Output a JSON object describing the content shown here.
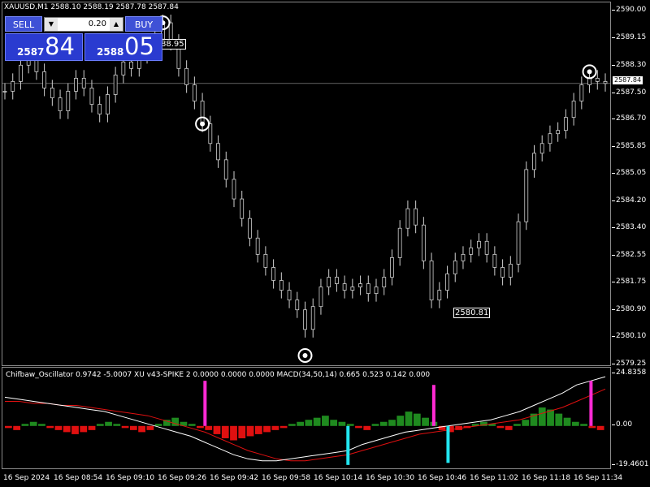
{
  "header": {
    "symbol_line": "XAUUSD,M1  2588.10 2588.19 2587.78 2587.84"
  },
  "trade_panel": {
    "sell_label": "SELL",
    "buy_label": "BUY",
    "lot_value": "0.20",
    "sell_small": "2587",
    "sell_big": "84",
    "buy_small": "2588",
    "buy_big": "05"
  },
  "price_axis": {
    "ticks": [
      "2590.00",
      "2589.15",
      "2588.30",
      "2587.50",
      "2586.70",
      "2585.85",
      "2585.05",
      "2584.20",
      "2583.40",
      "2582.55",
      "2581.75",
      "2580.90",
      "2580.10",
      "2579.25"
    ],
    "current_price": "2587.84"
  },
  "annotations": {
    "low_label": "2580.81",
    "hi_label": "88.95"
  },
  "oscillator": {
    "header": "Chifbaw_Oscillator 0.9742 -5.0007  XU v43-SPIKE 2 0.0000 0.0000 0.0000  MACD(34,50,14) 0.665 0.523 0.142 0.000",
    "axis_ticks": [
      "24.8358",
      "0.00",
      "-19.4601"
    ]
  },
  "time_axis": {
    "ticks": [
      "16 Sep 2024",
      "16 Sep 08:54",
      "16 Sep 09:10",
      "16 Sep 09:26",
      "16 Sep 09:42",
      "16 Sep 09:58",
      "16 Sep 10:14",
      "16 Sep 10:30",
      "16 Sep 10:46",
      "16 Sep 11:02",
      "16 Sep 11:18",
      "16 Sep 11:34"
    ]
  },
  "chart_data": {
    "type": "line",
    "price_series": [
      2587.6,
      2587.9,
      2588.4,
      2588.6,
      2588.2,
      2587.7,
      2587.4,
      2587.0,
      2587.6,
      2588.0,
      2587.7,
      2587.2,
      2586.9,
      2587.5,
      2588.1,
      2588.5,
      2588.3,
      2588.7,
      2588.9,
      2589.2,
      2589.7,
      2589.1,
      2588.3,
      2587.8,
      2587.3,
      2586.6,
      2586.0,
      2585.5,
      2584.9,
      2584.3,
      2583.7,
      2583.1,
      2582.6,
      2582.2,
      2581.8,
      2581.5,
      2581.2,
      2580.9,
      2580.3,
      2581.0,
      2581.6,
      2581.9,
      2581.7,
      2581.5,
      2581.6,
      2581.7,
      2581.4,
      2581.6,
      2581.9,
      2582.5,
      2583.4,
      2584.0,
      2583.5,
      2582.4,
      2581.2,
      2581.5,
      2582.0,
      2582.4,
      2582.6,
      2582.8,
      2583.0,
      2582.6,
      2582.2,
      2581.9,
      2582.3,
      2583.6,
      2585.2,
      2585.7,
      2586.0,
      2586.3,
      2586.4,
      2586.8,
      2587.3,
      2587.8,
      2588.0,
      2587.9,
      2587.84
    ],
    "swing_markers": [
      {
        "price": 2589.7
      },
      {
        "price": 2586.6
      },
      {
        "price": 2579.5
      },
      {
        "price": 2588.2
      }
    ],
    "osc_histogram": [
      -1,
      -2,
      1,
      2,
      1,
      -1,
      -2,
      -3,
      -4,
      -3,
      -2,
      1,
      2,
      1,
      -1,
      -2,
      -3,
      -2,
      1,
      3,
      4,
      2,
      1,
      -1,
      -2,
      -4,
      -6,
      -7,
      -6,
      -5,
      -4,
      -3,
      -2,
      -1,
      1,
      2,
      3,
      4,
      5,
      3,
      2,
      1,
      -1,
      -2,
      1,
      2,
      3,
      5,
      7,
      6,
      4,
      2,
      -2,
      -3,
      -2,
      -1,
      1,
      2,
      1,
      -1,
      -2,
      1,
      3,
      6,
      9,
      8,
      6,
      4,
      2,
      1,
      -1,
      -2
    ],
    "osc_line_white": [
      14,
      13,
      12,
      11,
      10,
      9,
      8,
      7,
      5,
      3,
      1,
      -1,
      -3,
      -5,
      -8,
      -11,
      -14,
      -16,
      -17,
      -17,
      -16,
      -15,
      -14,
      -13,
      -12,
      -9,
      -7,
      -5,
      -3,
      -2,
      -1,
      0,
      1,
      2,
      3,
      5,
      7,
      10,
      13,
      16,
      20,
      22,
      24
    ],
    "osc_line_red": [
      12,
      12,
      11,
      11,
      10,
      10,
      9,
      8,
      7,
      6,
      5,
      3,
      1,
      -1,
      -3,
      -6,
      -9,
      -12,
      -14,
      -16,
      -17,
      -17,
      -16,
      -15,
      -14,
      -12,
      -10,
      -8,
      -6,
      -4,
      -3,
      -2,
      -1,
      0,
      1,
      2,
      3,
      5,
      7,
      9,
      12,
      15,
      18
    ],
    "spikes": [
      {
        "kind": "magenta",
        "index": 14,
        "value": 22
      },
      {
        "kind": "cyan",
        "index": 24,
        "value": -19
      },
      {
        "kind": "magenta",
        "index": 30,
        "value": 20
      },
      {
        "kind": "cyan",
        "index": 31,
        "value": -18
      },
      {
        "kind": "magenta",
        "index": 41,
        "value": 22
      }
    ]
  }
}
